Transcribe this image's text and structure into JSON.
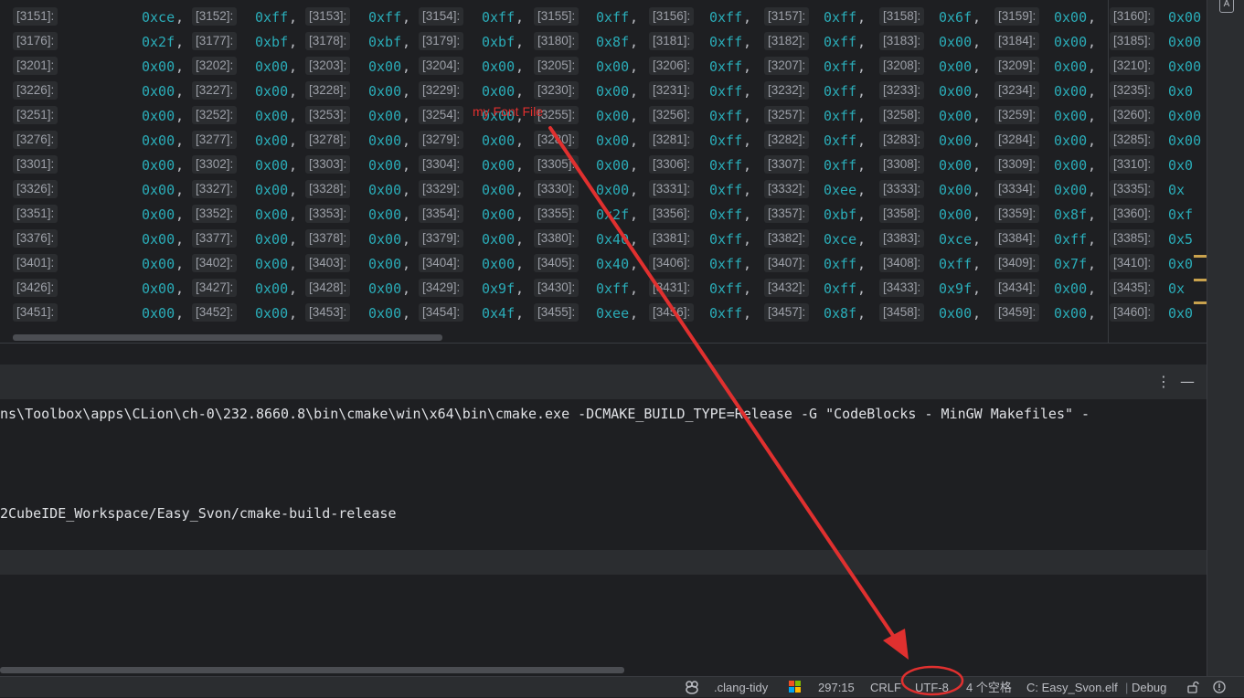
{
  "editor": {
    "rows": [
      {
        "first": "[3151]:",
        "cells": [
          [
            "",
            "0xce"
          ],
          [
            "[3152]:",
            "0xff"
          ],
          [
            "[3153]:",
            "0xff"
          ],
          [
            "[3154]:",
            "0xff"
          ],
          [
            "[3155]:",
            "0xff"
          ],
          [
            "[3156]:",
            "0xff"
          ],
          [
            "[3157]:",
            "0xff"
          ],
          [
            "[3158]:",
            "0x6f"
          ],
          [
            "[3159]:",
            "0x00"
          ],
          [
            "[3160]:",
            "0x00"
          ]
        ]
      },
      {
        "first": "[3176]:",
        "cells": [
          [
            "",
            "0x2f"
          ],
          [
            "[3177]:",
            "0xbf"
          ],
          [
            "[3178]:",
            "0xbf"
          ],
          [
            "[3179]:",
            "0xbf"
          ],
          [
            "[3180]:",
            "0x8f"
          ],
          [
            "[3181]:",
            "0xff"
          ],
          [
            "[3182]:",
            "0xff"
          ],
          [
            "[3183]:",
            "0x00"
          ],
          [
            "[3184]:",
            "0x00"
          ],
          [
            "[3185]:",
            "0x00"
          ]
        ]
      },
      {
        "first": "[3201]:",
        "cells": [
          [
            "",
            "0x00"
          ],
          [
            "[3202]:",
            "0x00"
          ],
          [
            "[3203]:",
            "0x00"
          ],
          [
            "[3204]:",
            "0x00"
          ],
          [
            "[3205]:",
            "0x00"
          ],
          [
            "[3206]:",
            "0xff"
          ],
          [
            "[3207]:",
            "0xff"
          ],
          [
            "[3208]:",
            "0x00"
          ],
          [
            "[3209]:",
            "0x00"
          ],
          [
            "[3210]:",
            "0x00"
          ]
        ]
      },
      {
        "first": "[3226]:",
        "cells": [
          [
            "",
            "0x00"
          ],
          [
            "[3227]:",
            "0x00"
          ],
          [
            "[3228]:",
            "0x00"
          ],
          [
            "[3229]:",
            "0x00"
          ],
          [
            "[3230]:",
            "0x00"
          ],
          [
            "[3231]:",
            "0xff"
          ],
          [
            "[3232]:",
            "0xff"
          ],
          [
            "[3233]:",
            "0x00"
          ],
          [
            "[3234]:",
            "0x00"
          ],
          [
            "[3235]:",
            "0x0"
          ]
        ]
      },
      {
        "first": "[3251]:",
        "cells": [
          [
            "",
            "0x00"
          ],
          [
            "[3252]:",
            "0x00"
          ],
          [
            "[3253]:",
            "0x00"
          ],
          [
            "[3254]:",
            "0x00"
          ],
          [
            "[3255]:",
            "0x00"
          ],
          [
            "[3256]:",
            "0xff"
          ],
          [
            "[3257]:",
            "0xff"
          ],
          [
            "[3258]:",
            "0x00"
          ],
          [
            "[3259]:",
            "0x00"
          ],
          [
            "[3260]:",
            "0x00"
          ]
        ]
      },
      {
        "first": "[3276]:",
        "cells": [
          [
            "",
            "0x00"
          ],
          [
            "[3277]:",
            "0x00"
          ],
          [
            "[3278]:",
            "0x00"
          ],
          [
            "[3279]:",
            "0x00"
          ],
          [
            "[3280]:",
            "0x00"
          ],
          [
            "[3281]:",
            "0xff"
          ],
          [
            "[3282]:",
            "0xff"
          ],
          [
            "[3283]:",
            "0x00"
          ],
          [
            "[3284]:",
            "0x00"
          ],
          [
            "[3285]:",
            "0x00"
          ]
        ]
      },
      {
        "first": "[3301]:",
        "cells": [
          [
            "",
            "0x00"
          ],
          [
            "[3302]:",
            "0x00"
          ],
          [
            "[3303]:",
            "0x00"
          ],
          [
            "[3304]:",
            "0x00"
          ],
          [
            "[3305]:",
            "0x00"
          ],
          [
            "[3306]:",
            "0xff"
          ],
          [
            "[3307]:",
            "0xff"
          ],
          [
            "[3308]:",
            "0x00"
          ],
          [
            "[3309]:",
            "0x00"
          ],
          [
            "[3310]:",
            "0x0"
          ]
        ]
      },
      {
        "first": "[3326]:",
        "cells": [
          [
            "",
            "0x00"
          ],
          [
            "[3327]:",
            "0x00"
          ],
          [
            "[3328]:",
            "0x00"
          ],
          [
            "[3329]:",
            "0x00"
          ],
          [
            "[3330]:",
            "0x00"
          ],
          [
            "[3331]:",
            "0xff"
          ],
          [
            "[3332]:",
            "0xee"
          ],
          [
            "[3333]:",
            "0x00"
          ],
          [
            "[3334]:",
            "0x00"
          ],
          [
            "[3335]:",
            "0x"
          ]
        ]
      },
      {
        "first": "[3351]:",
        "cells": [
          [
            "",
            "0x00"
          ],
          [
            "[3352]:",
            "0x00"
          ],
          [
            "[3353]:",
            "0x00"
          ],
          [
            "[3354]:",
            "0x00"
          ],
          [
            "[3355]:",
            "0x2f"
          ],
          [
            "[3356]:",
            "0xff"
          ],
          [
            "[3357]:",
            "0xbf"
          ],
          [
            "[3358]:",
            "0x00"
          ],
          [
            "[3359]:",
            "0x8f"
          ],
          [
            "[3360]:",
            "0xf"
          ]
        ]
      },
      {
        "first": "[3376]:",
        "cells": [
          [
            "",
            "0x00"
          ],
          [
            "[3377]:",
            "0x00"
          ],
          [
            "[3378]:",
            "0x00"
          ],
          [
            "[3379]:",
            "0x00"
          ],
          [
            "[3380]:",
            "0x40"
          ],
          [
            "[3381]:",
            "0xff"
          ],
          [
            "[3382]:",
            "0xce"
          ],
          [
            "[3383]:",
            "0xce"
          ],
          [
            "[3384]:",
            "0xff"
          ],
          [
            "[3385]:",
            "0x5"
          ]
        ]
      },
      {
        "first": "[3401]:",
        "cells": [
          [
            "",
            "0x00"
          ],
          [
            "[3402]:",
            "0x00"
          ],
          [
            "[3403]:",
            "0x00"
          ],
          [
            "[3404]:",
            "0x00"
          ],
          [
            "[3405]:",
            "0x40"
          ],
          [
            "[3406]:",
            "0xff"
          ],
          [
            "[3407]:",
            "0xff"
          ],
          [
            "[3408]:",
            "0xff"
          ],
          [
            "[3409]:",
            "0x7f"
          ],
          [
            "[3410]:",
            "0x0"
          ]
        ]
      },
      {
        "first": "[3426]:",
        "cells": [
          [
            "",
            "0x00"
          ],
          [
            "[3427]:",
            "0x00"
          ],
          [
            "[3428]:",
            "0x00"
          ],
          [
            "[3429]:",
            "0x9f"
          ],
          [
            "[3430]:",
            "0xff"
          ],
          [
            "[3431]:",
            "0xff"
          ],
          [
            "[3432]:",
            "0xff"
          ],
          [
            "[3433]:",
            "0x9f"
          ],
          [
            "[3434]:",
            "0x00"
          ],
          [
            "[3435]:",
            "0x"
          ]
        ]
      },
      {
        "first": "[3451]:",
        "cells": [
          [
            "",
            "0x00"
          ],
          [
            "[3452]:",
            "0x00"
          ],
          [
            "[3453]:",
            "0x00"
          ],
          [
            "[3454]:",
            "0x4f"
          ],
          [
            "[3455]:",
            "0xee"
          ],
          [
            "[3456]:",
            "0xff"
          ],
          [
            "[3457]:",
            "0x8f"
          ],
          [
            "[3458]:",
            "0x00"
          ],
          [
            "[3459]:",
            "0x00"
          ],
          [
            "[3460]:",
            "0x0"
          ]
        ]
      }
    ]
  },
  "annotation": {
    "text": "my Font File"
  },
  "tool_window": {
    "more_label": "⋮",
    "minimize_label": "—"
  },
  "console": {
    "line1": "ns\\Toolbox\\apps\\CLion\\ch-0\\232.8660.8\\bin\\cmake\\win\\x64\\bin\\cmake.exe -DCMAKE_BUILD_TYPE=Release -G \"CodeBlocks - MinGW Makefiles\" -",
    "line2": "2CubeIDE_Workspace/Easy_Svon/cmake-build-release"
  },
  "statusbar": {
    "clang_tidy": ".clang-tidy",
    "position": "297:15",
    "line_sep": "CRLF",
    "encoding": "UTF-8",
    "indent": "4 个空格",
    "context": "C: Easy_Svon.elf",
    "config": "Debug"
  },
  "icons": {
    "ai": "A",
    "lock": "lock-icon",
    "warn": "!"
  },
  "colors": {
    "hex_value": "#2aacb8",
    "annotation": "#e0302f",
    "background": "#1e1f22"
  }
}
